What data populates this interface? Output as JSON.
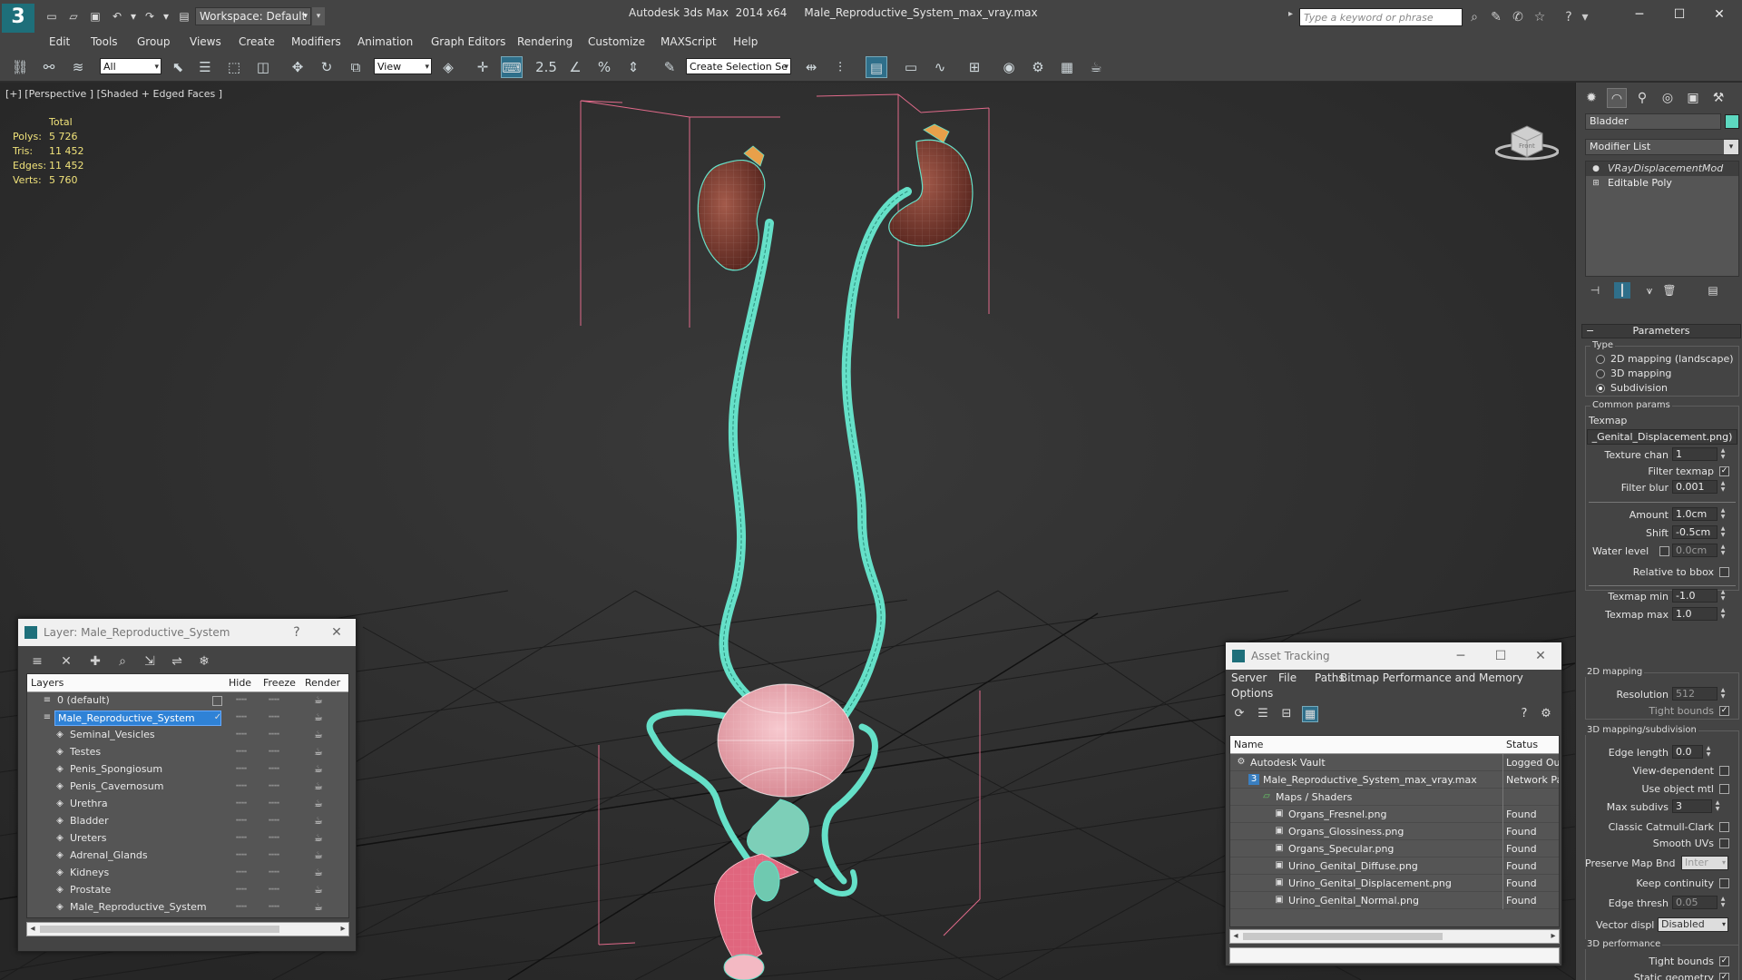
{
  "app": {
    "logo": "3",
    "workspace": "Workspace: Default",
    "title": "Autodesk 3ds Max  2014 x64     Male_Reproductive_System_max_vray.max",
    "search_placeholder": "Type a keyword or phrase"
  },
  "menu": [
    "Edit",
    "Tools",
    "Group",
    "Views",
    "Create",
    "Modifiers",
    "Animation",
    "Graph Editors",
    "Rendering",
    "Customize",
    "MAXScript",
    "Help"
  ],
  "toolbar": {
    "selection_filter": "All",
    "ref_coord": "View",
    "named_selection": "Create Selection Se"
  },
  "viewport": {
    "label": "[+] [Perspective ] [Shaded + Edged Faces ]",
    "stats": {
      "header": "Total",
      "rows": [
        {
          "label": "Polys:",
          "value": "5 726"
        },
        {
          "label": "Tris:",
          "value": "11 452"
        },
        {
          "label": "Edges:",
          "value": "11 452"
        },
        {
          "label": "Verts:",
          "value": "5 760"
        }
      ]
    },
    "viewcube_label": "Front"
  },
  "layer_panel": {
    "title": "Layer: Male_Reproductive_System",
    "columns": {
      "layers": "Layers",
      "hide": "Hide",
      "freeze": "Freeze",
      "render": "Render"
    },
    "rows": [
      {
        "name": "0 (default)"
      },
      {
        "name": "Male_Reproductive_System"
      },
      {
        "name": "Seminal_Vesicles"
      },
      {
        "name": "Testes"
      },
      {
        "name": "Penis_Spongiosum"
      },
      {
        "name": "Penis_Cavernosum"
      },
      {
        "name": "Urethra"
      },
      {
        "name": "Bladder"
      },
      {
        "name": "Ureters"
      },
      {
        "name": "Adrenal_Glands"
      },
      {
        "name": "Kidneys"
      },
      {
        "name": "Prostate"
      },
      {
        "name": "Male_Reproductive_System"
      }
    ]
  },
  "asset_panel": {
    "title": "Asset Tracking",
    "menu": [
      "Server",
      "File",
      "Paths",
      "Bitmap Performance and Memory",
      "Options"
    ],
    "columns": {
      "name": "Name",
      "status": "Status"
    },
    "rows": [
      {
        "name": "Autodesk Vault",
        "status": "Logged Ou"
      },
      {
        "name": "Male_Reproductive_System_max_vray.max",
        "status": "Network Pa"
      },
      {
        "name": "Maps / Shaders",
        "status": ""
      },
      {
        "name": "Organs_Fresnel.png",
        "status": "Found"
      },
      {
        "name": "Organs_Glossiness.png",
        "status": "Found"
      },
      {
        "name": "Organs_Specular.png",
        "status": "Found"
      },
      {
        "name": "Urino_Genital_Diffuse.png",
        "status": "Found"
      },
      {
        "name": "Urino_Genital_Displacement.png",
        "status": "Found"
      },
      {
        "name": "Urino_Genital_Normal.png",
        "status": "Found"
      }
    ]
  },
  "command_panel": {
    "object_name": "Bladder",
    "object_color": "#5dd8c0",
    "modifier_list": "Modifier List",
    "stack": [
      "VRayDisplacementMod",
      "Editable Poly"
    ],
    "parameters_title": "Parameters",
    "type_group": "Type",
    "type_options": [
      "2D mapping (landscape)",
      "3D mapping",
      "Subdivision"
    ],
    "common_params": "Common params",
    "texmap_label": "Texmap",
    "texmap_value": "_Genital_Displacement.png)",
    "texture_chan_label": "Texture chan",
    "texture_chan": "1",
    "filter_texmap": "Filter texmap",
    "filter_blur_label": "Filter blur",
    "filter_blur": "0.001",
    "amount_label": "Amount",
    "amount": "1.0cm",
    "shift_label": "Shift",
    "shift": "-0.5cm",
    "water_level_label": "Water level",
    "water_level": "0.0cm",
    "relative_bbox": "Relative to bbox",
    "texmap_min_label": "Texmap min",
    "texmap_min": "-1.0",
    "texmap_max_label": "Texmap max",
    "texmap_max": "1.0",
    "mapping_2d": "2D mapping",
    "resolution_label": "Resolution",
    "resolution": "512",
    "tight_bounds": "Tight bounds",
    "mapping_3d": "3D mapping/subdivision",
    "edge_length_label": "Edge length",
    "edge_length": "0.0",
    "view_dependent": "View-dependent",
    "use_object_mtl": "Use object mtl",
    "max_subdivs_label": "Max subdivs",
    "max_subdivs": "3",
    "classic_catmull": "Classic Catmull-Clark",
    "smooth_uvs": "Smooth UVs",
    "preserve_map_label": "Preserve Map Bnd",
    "preserve_map": "Inter",
    "keep_continuity": "Keep continuity",
    "edge_thresh_label": "Edge thresh",
    "edge_thresh": "0.05",
    "vector_displ_label": "Vector displ",
    "vector_displ": "Disabled",
    "perf_3d": "3D performance",
    "tight_bounds_2": "Tight bounds",
    "static_geometry": "Static geometry"
  }
}
